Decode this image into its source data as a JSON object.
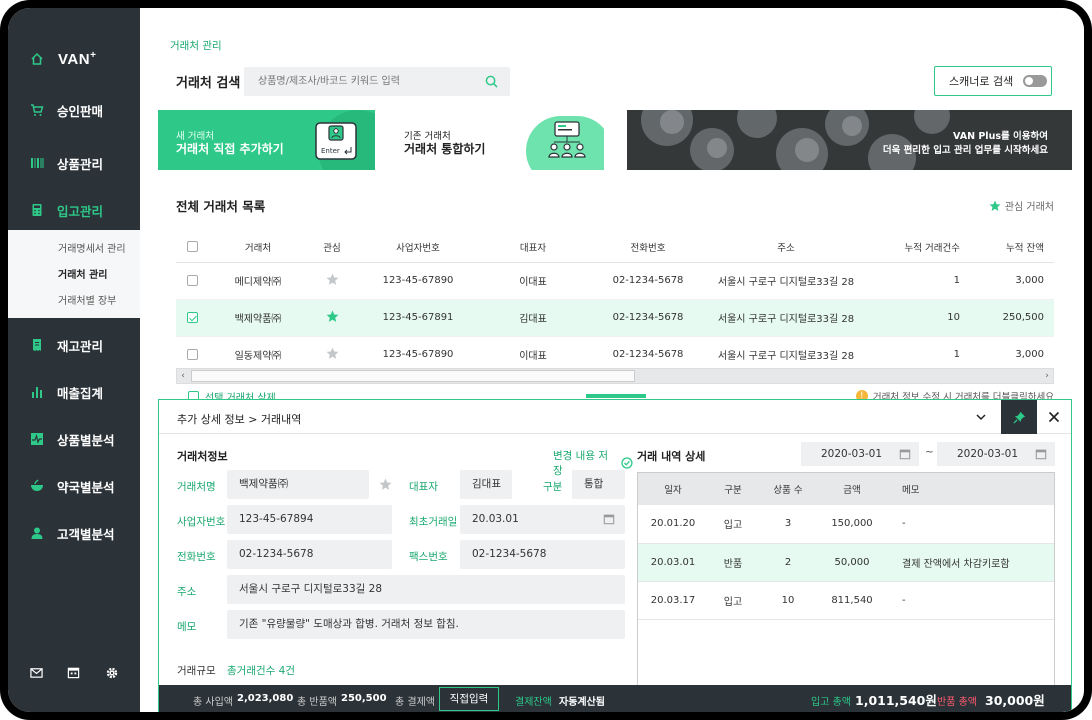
{
  "colors": {
    "accent": "#2ec989",
    "sidebar": "#2b3339",
    "highlight_row": "#e6faf1",
    "danger": "#ff5a6e"
  },
  "sidebar": {
    "logo": "VAN",
    "logo_sup": "+",
    "items": [
      {
        "label": "승인판매",
        "icon": "cart-icon"
      },
      {
        "label": "상품관리",
        "icon": "barcode-icon"
      },
      {
        "label": "입고관리",
        "icon": "calculator-icon",
        "active": true
      },
      {
        "label": "재고관리",
        "icon": "receipt-icon"
      },
      {
        "label": "매출집계",
        "icon": "bar-chart-icon"
      },
      {
        "label": "상품별분석",
        "icon": "pulse-chart-icon"
      },
      {
        "label": "약국별분석",
        "icon": "bowl-icon"
      },
      {
        "label": "고객별분석",
        "icon": "person-icon"
      }
    ],
    "subitems": [
      {
        "label": "거래명세서 관리"
      },
      {
        "label": "거래처 관리",
        "active": true
      },
      {
        "label": "거래처별 장부"
      }
    ],
    "bottom_icons": [
      "mail-icon",
      "calendar-icon",
      "gear-icon"
    ]
  },
  "breadcrumb": "거래처 관리",
  "search": {
    "title": "거래처 검색",
    "placeholder": "상품명/제조사/바코드 키워드 입력",
    "scan_label": "스캐너로 검색"
  },
  "cards": {
    "new_sub": "새 거래처",
    "new_title": "거래처 직접 추가하기",
    "merge_sub": "기존 거래처",
    "merge_title": "거래처 통합하기",
    "banner_line1": "VAN Plus를 이용하여",
    "banner_line2": "더욱 편리한 입고 관리 업무를 시작하세요"
  },
  "list": {
    "title": "전체 거래처 목록",
    "fav_legend": "관심 거래처",
    "columns": [
      "거래처",
      "관심",
      "사업자번호",
      "대표자",
      "전화번호",
      "주소",
      "누적 거래건수",
      "누적 잔액"
    ],
    "rows": [
      {
        "name": "메디제약㈜",
        "biz": "123-45-67890",
        "ceo": "이대표",
        "phone": "02-1234-5678",
        "addr": "서울시 구로구 디지털로33길 28",
        "count": "1",
        "balance": "3,000",
        "checked": false,
        "fav": false
      },
      {
        "name": "백제약품㈜",
        "biz": "123-45-67891",
        "ceo": "김대표",
        "phone": "02-1234-5678",
        "addr": "서울시 구로구 디지털로33길 28",
        "count": "10",
        "balance": "250,500",
        "checked": true,
        "fav": true
      },
      {
        "name": "일동제약㈜",
        "biz": "123-45-67890",
        "ceo": "이대표",
        "phone": "02-1234-5678",
        "addr": "서울시 구로구 디지털로33길 28",
        "count": "1",
        "balance": "3,000",
        "checked": false,
        "fav": false
      }
    ],
    "delete_label": "선택 거래처 삭제",
    "hint": "거래처 정보 수정 시 거래처를 더블클릭하세요"
  },
  "detail": {
    "header": "추가 상세 정보 > 거래내역",
    "info_title": "거래처정보",
    "save_label": "변경 내용 저장",
    "fields": {
      "name_label": "거래처명",
      "name_value": "백제약품㈜",
      "ceo_label": "대표자",
      "ceo_value": "김대표",
      "type_label": "구분",
      "type_value": "통합",
      "biz_label": "사업자번호",
      "biz_value": "123-45-67894",
      "first_label": "최초거래일",
      "first_value": "20.03.01",
      "phone_label": "전화번호",
      "phone_value": "02-1234-5678",
      "fax_label": "팩스번호",
      "fax_value": "02-1234-5678",
      "addr_label": "주소",
      "addr_value": "서울시 구로구 디지털로33길 28",
      "memo_label": "메모",
      "memo_value": "기존 \"유량물량\" 도매상과 합병. 거래처 정보 합침."
    },
    "scale_label": "거래규모",
    "scale_value": "총거래건수  4건",
    "footer": {
      "buy_label": "총 사입액",
      "buy_value": "2,023,080",
      "return_label": "총 반품액",
      "return_value": "250,500",
      "pay_label": "총 결제액",
      "pay_button": "직접입력",
      "bal_label": "결제잔액",
      "bal_value": "자동계산됨"
    },
    "history": {
      "title": "거래 내역 상세",
      "date_from": "2020-03-01",
      "date_to": "2020-03-01",
      "tilde": "~",
      "columns": [
        "일자",
        "구분",
        "상품 수",
        "금액",
        "메모"
      ],
      "rows": [
        {
          "date": "20.01.20",
          "type": "입고",
          "qty": "3",
          "amount": "150,000",
          "memo": "-"
        },
        {
          "date": "20.03.01",
          "type": "반품",
          "qty": "2",
          "amount": "50,000",
          "memo": "결제 잔액에서 차감키로함"
        },
        {
          "date": "20.03.17",
          "type": "입고",
          "qty": "10",
          "amount": "811,540",
          "memo": "-"
        }
      ],
      "in_total_label": "입고 총액",
      "in_total_value": "1,011,540원",
      "ret_total_label": "반품 총액",
      "ret_total_value": "30,000원"
    }
  }
}
